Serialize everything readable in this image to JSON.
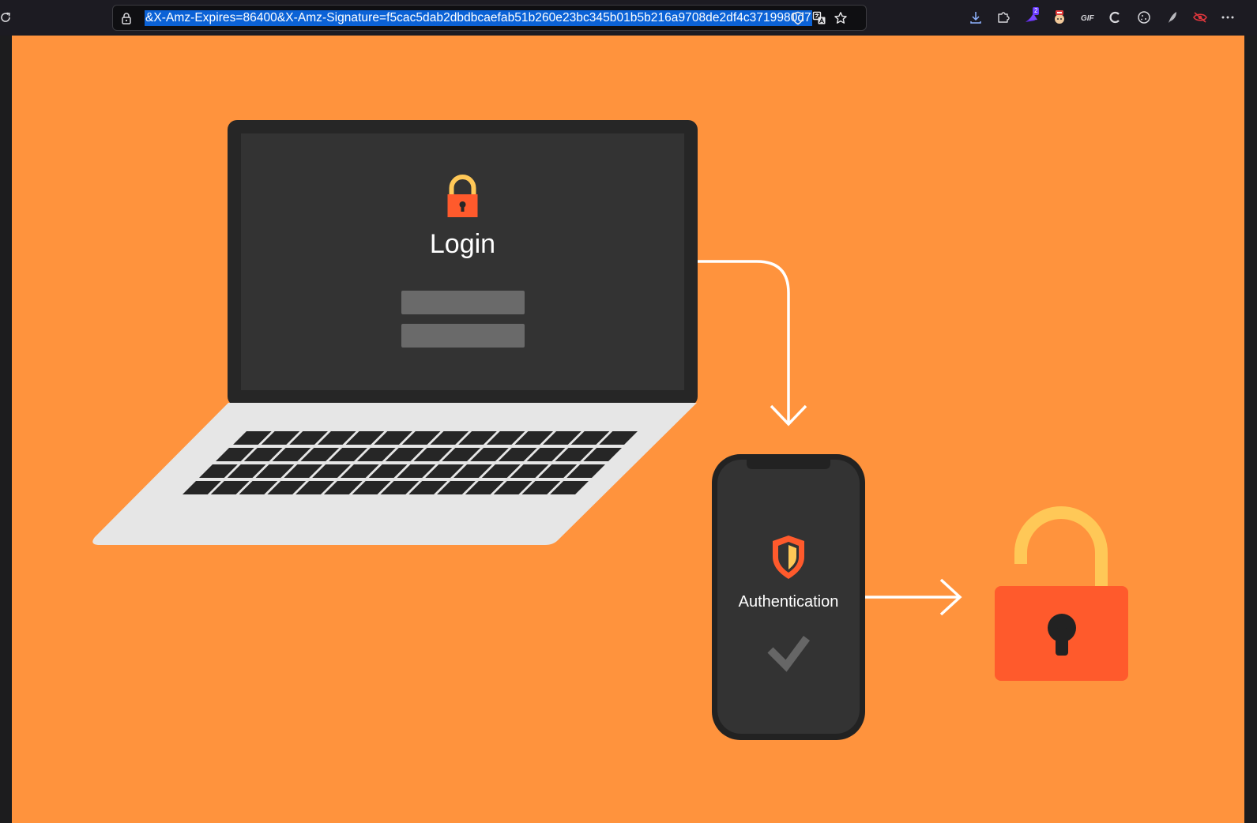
{
  "browser": {
    "url": "&X-Amz-Expires=86400&X-Amz-Signature=f5cac5dab2dbdbcaefab51b260e23bc345b01b5b216a9708de2df4c3719980d7",
    "extension_badge": "2",
    "icons": {
      "reload": "reload-icon",
      "site_info": "lock-icon",
      "tracking": "shield-icon",
      "translate": "translate-icon",
      "bookmark": "star-icon",
      "downloads": "download-icon",
      "extensions": "puzzle-icon",
      "menu": "more-icon"
    }
  },
  "illustration": {
    "laptop": {
      "title": "Login"
    },
    "phone": {
      "title": "Authentication"
    }
  },
  "colors": {
    "background": "#ff933d",
    "dark": "#333333",
    "accent_red": "#ff5a2c",
    "accent_yellow": "#ffc857",
    "white": "#ffffff"
  }
}
